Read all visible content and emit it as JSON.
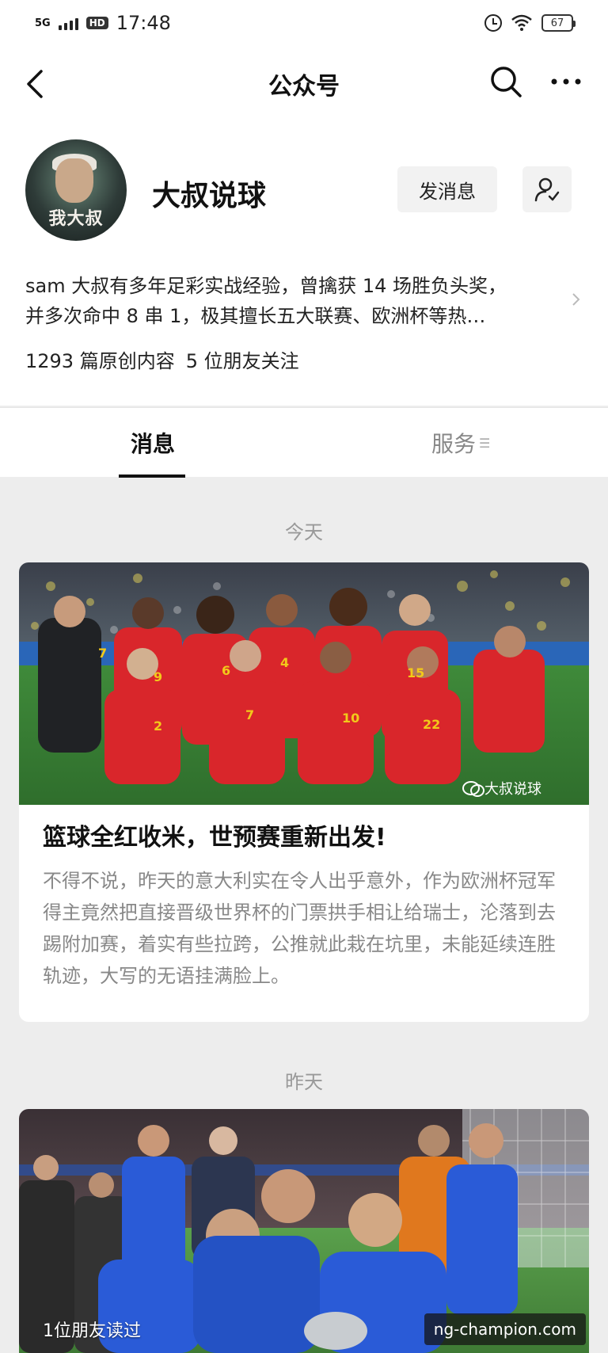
{
  "status_bar": {
    "network": "5G",
    "hd": "HD",
    "time": "17:48",
    "battery": "67"
  },
  "nav": {
    "title": "公众号"
  },
  "account": {
    "avatar_text": "我大叔",
    "name": "大叔说球",
    "message_button": "发消息",
    "intro_line1": "sam 大叔有多年足彩实战经验，曾擒获 14 场胜负头奖，",
    "intro_line2": "并多次命中 8 串 1，极其擅长五大联赛、欧洲杯等热…",
    "original_count": "1293 篇原创内容",
    "friends_following": "5 位朋友关注"
  },
  "tabs": {
    "messages": "消息",
    "services": "服务"
  },
  "feed": [
    {
      "date": "今天",
      "watermark": "大叔说球",
      "title": "篮球全红收米，世预赛重新出发!",
      "summary": "不得不说，昨天的意大利实在令人出乎意外，作为欧洲杯冠军得主竟然把直接晋级世界杯的门票拱手相让给瑞士，沦落到去踢附加赛，着实有些拉跨，公推就此栽在坑里，未能延续连胜轨迹，大写的无语挂满脸上。"
    },
    {
      "date": "昨天",
      "friends_read": "1位朋友读过",
      "site_badge": "ng-champion.com"
    }
  ],
  "colors": {
    "background": "#ededed",
    "card": "#ffffff",
    "muted_text": "#888888",
    "belgium_red": "#d9262b",
    "italy_blue": "#2a5bd7"
  }
}
